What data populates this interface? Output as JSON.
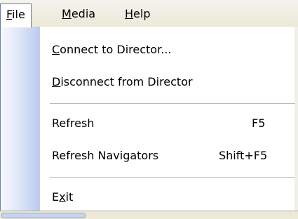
{
  "menubar": {
    "items": [
      {
        "before": "",
        "key": "F",
        "after": "ile"
      },
      {
        "before": "",
        "key": "M",
        "after": "edia"
      },
      {
        "before": "",
        "key": "H",
        "after": "elp"
      }
    ]
  },
  "file_menu": {
    "connect": {
      "before": "",
      "key": "C",
      "after": "onnect to Director..."
    },
    "disconnect": {
      "before": "",
      "key": "D",
      "after": "isconnect from Director"
    },
    "refresh": {
      "label": "Refresh",
      "shortcut": "F5"
    },
    "refresh_navigators": {
      "label": "Refresh Navigators",
      "shortcut": "Shift+F5"
    },
    "exit": {
      "before": "E",
      "key": "x",
      "after": "it"
    }
  },
  "colors": {
    "menu_border": "#6d7a9c",
    "separator": "#a7bbe5",
    "gutter": "#b9cbf0",
    "menubar_bg": "#ece9d8"
  }
}
